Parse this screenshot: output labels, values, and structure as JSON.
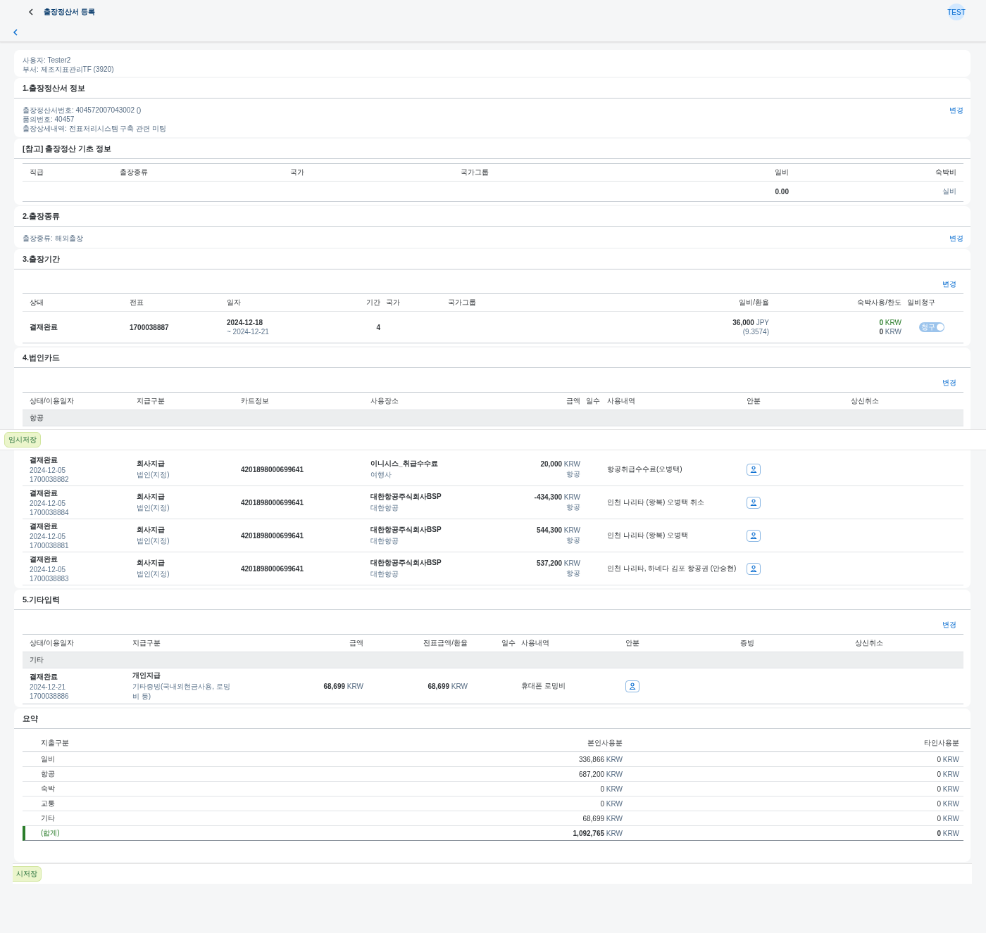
{
  "header": {
    "title": "출장정산서 등록",
    "avatar": "TEST"
  },
  "user_info": {
    "lines": [
      "사용자: Tester2",
      "부서: 제조지표관리TF (3920)"
    ]
  },
  "trip_info": {
    "title": "1.출장정산서 정보",
    "lines": [
      "출장정산서번호: 404572007043002 ()",
      "품의번호: 40457",
      "출장상세내역: 전표처리시스템 구축 관련 미팅"
    ],
    "change_link": "변경"
  },
  "reference": {
    "title": "[참고] 출장정산 기초 정보",
    "columns": [
      "직급",
      "출장종류",
      "국가",
      "국가그룹",
      "일비",
      "숙박비"
    ],
    "row": {
      "daily": "0.00",
      "lodging": "실비"
    }
  },
  "trip_type": {
    "title": "2.출장종류",
    "line": "출장종류: 해외출장",
    "change_link": "변경"
  },
  "trip_period": {
    "title": "3.출장기간",
    "change_link": "변경",
    "columns": [
      "상태",
      "전표",
      "일자",
      "기간",
      "국가",
      "국가그룹",
      "일비/환율",
      "숙박사용/한도",
      "일비청구"
    ],
    "rows": [
      {
        "status": "결재완료",
        "voucher": "1700038887",
        "date_from": "2024-12-18",
        "date_to": "~ 2024-12-21",
        "days": "4",
        "daily_amount": "36,000",
        "daily_currency": "JPY",
        "rate": "(9.3574)",
        "lodging_used": "0",
        "lodging_used_currency": "KRW",
        "lodging_limit": "0",
        "lodging_limit_currency": "KRW",
        "claim": {
          "label": "청구",
          "on": true,
          "disabled": true
        }
      }
    ]
  },
  "corporate_card": {
    "title": "4.법인카드",
    "change_link": "변경",
    "columns": [
      "상태/이용일자",
      "지급구분",
      "카드정보",
      "사용장소",
      "금액",
      "일수",
      "사용내역",
      "안분",
      "상신취소"
    ],
    "group": "항공",
    "rows": [
      {
        "status": "결재완료",
        "date": "2024-12-05",
        "voucher": "1700038882",
        "payment": "회사지급",
        "payment_sub": "법인(지정)",
        "card": "4201898000699641",
        "place": "이니시스_취급수수료",
        "place_sub": "여행사",
        "amount": "20,000",
        "currency": "KRW",
        "category": "항공",
        "usage": "항공취급수수료(오병택)"
      },
      {
        "status": "결재완료",
        "date": "2024-12-05",
        "voucher": "1700038884",
        "payment": "회사지급",
        "payment_sub": "법인(지정)",
        "card": "4201898000699641",
        "place": "대한항공주식회사BSP",
        "place_sub": "대한항공",
        "amount": "-434,300",
        "currency": "KRW",
        "category": "항공",
        "usage": "인천 나리타 (왕복) 오병택 취소"
      },
      {
        "status": "결재완료",
        "date": "2024-12-05",
        "voucher": "1700038881",
        "payment": "회사지급",
        "payment_sub": "법인(지정)",
        "card": "4201898000699641",
        "place": "대한항공주식회사BSP",
        "place_sub": "대한항공",
        "amount": "544,300",
        "currency": "KRW",
        "category": "항공",
        "usage": "인천 나리타 (왕복) 오병택"
      },
      {
        "status": "결재완료",
        "date": "2024-12-05",
        "voucher": "1700038883",
        "payment": "회사지급",
        "payment_sub": "법인(지정)",
        "card": "4201898000699641",
        "place": "대한항공주식회사BSP",
        "place_sub": "대한항공",
        "amount": "537,200",
        "currency": "KRW",
        "category": "항공",
        "usage": "인천 나리타, 하네다 김포 항공권 (안승현)"
      }
    ]
  },
  "temp_save_bar": {
    "button": "임시저장"
  },
  "other_input": {
    "title": "5.기타입력",
    "change_link": "변경",
    "columns": [
      "상태/이용일자",
      "지급구분",
      "금액",
      "전표금액/환율",
      "일수",
      "사용내역",
      "안분",
      "증빙",
      "상신취소"
    ],
    "group": "기타",
    "rows": [
      {
        "status": "결재완료",
        "date": "2024-12-21",
        "voucher": "1700038886",
        "payment": "개인지급",
        "payment_sub": "기타증빙(국내외현금사용, 로밍비 등)",
        "amount": "68,699",
        "currency": "KRW",
        "voucher_amount": "68,699",
        "voucher_currency": "KRW",
        "usage": "휴대폰 로밍비"
      }
    ]
  },
  "summary": {
    "title": "요약",
    "columns": [
      "지출구분",
      "본인사용분",
      "타인사용분"
    ],
    "rows": [
      {
        "label": "일비",
        "own": "336,866",
        "own_currency": "KRW",
        "other": "0",
        "other_currency": "KRW"
      },
      {
        "label": "항공",
        "own": "687,200",
        "own_currency": "KRW",
        "other": "0",
        "other_currency": "KRW"
      },
      {
        "label": "숙박",
        "own": "0",
        "own_currency": "KRW",
        "other": "0",
        "other_currency": "KRW"
      },
      {
        "label": "교통",
        "own": "0",
        "own_currency": "KRW",
        "other": "0",
        "other_currency": "KRW"
      },
      {
        "label": "기타",
        "own": "68,699",
        "own_currency": "KRW",
        "other": "0",
        "other_currency": "KRW"
      }
    ],
    "total": {
      "label": "(합계)",
      "own": "1,092,765",
      "own_currency": "KRW",
      "other": "0",
      "other_currency": "KRW"
    }
  },
  "bottom_bar": {
    "button": "시저장"
  }
}
